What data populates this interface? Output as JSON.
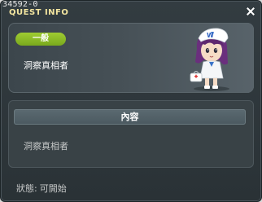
{
  "window": {
    "quest_id": "34592-0",
    "title": "QUEST INFO",
    "close_icon": "close-icon"
  },
  "info": {
    "category": "一般",
    "quest_name": "洞察真相者",
    "category_color": "#8fbd2a",
    "npc_icon": "npc-portrait-icon"
  },
  "content": {
    "header": "內容",
    "text": "洞察真相者"
  },
  "status": {
    "label": "狀態:",
    "value": "可開始"
  }
}
